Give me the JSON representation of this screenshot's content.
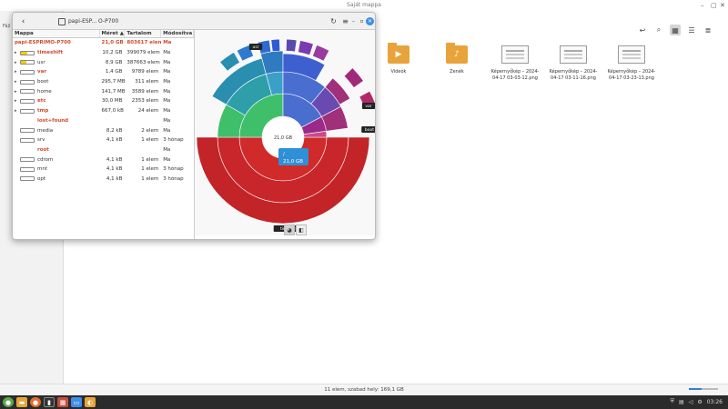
{
  "fm": {
    "title": "Saját mappa",
    "sidebar_label": "Fájl",
    "files": [
      {
        "name": "Videók",
        "type": "folder",
        "icon": "video-icon"
      },
      {
        "name": "Zenék",
        "type": "folder",
        "icon": "music-icon"
      },
      {
        "name": "Képernyőkép – 2024-04-17 03-03-12.png",
        "type": "image"
      },
      {
        "name": "Képernyőkép – 2024-04-17 03-11-16.png",
        "type": "image"
      },
      {
        "name": "Képernyőkép – 2024-04-17 03-23-13.png",
        "type": "image"
      }
    ],
    "status": "11 elem, szabad hely: 169,1 GB"
  },
  "taskbar": {
    "clock": "03:26",
    "zoom_fill": 0.45
  },
  "dua": {
    "location": "papi-ESP...   O-P700",
    "columns": {
      "name": "Mappa",
      "size": "Méret",
      "contents": "Tartalom",
      "modified": "Módosítva"
    },
    "rows": [
      {
        "name": "papi-ESPRIMO-P700",
        "size": "21,0 GB",
        "contents": "803617 elem",
        "modified": "Ma",
        "root": true
      },
      {
        "name": "timeshift",
        "size": "10,2 GB",
        "contents": "399079 elem",
        "modified": "Ma",
        "red": true,
        "fill": 0.5
      },
      {
        "name": "usr",
        "size": "8,9 GB",
        "contents": "387663 elem",
        "modified": "Ma",
        "fill": 0.4
      },
      {
        "name": "var",
        "size": "1,4 GB",
        "contents": "9789 elem",
        "modified": "Ma",
        "red": true
      },
      {
        "name": "boot",
        "size": "295,7 MB",
        "contents": "311 elem",
        "modified": "Ma"
      },
      {
        "name": "home",
        "size": "141,7 MB",
        "contents": "3589 elem",
        "modified": "Ma"
      },
      {
        "name": "etc",
        "size": "30,0 MB",
        "contents": "2353 elem",
        "modified": "Ma",
        "red": true
      },
      {
        "name": "tmp",
        "size": "667,0 kB",
        "contents": "24 elem",
        "modified": "Ma",
        "red": true
      },
      {
        "name": "lost+found",
        "size": "",
        "contents": "",
        "modified": "Ma",
        "red": true,
        "nobar": true
      },
      {
        "name": "media",
        "size": "8,2 kB",
        "contents": "2 elem",
        "modified": "Ma"
      },
      {
        "name": "srv",
        "size": "4,1 kB",
        "contents": "1 elem",
        "modified": "3 hónap"
      },
      {
        "name": "root",
        "size": "",
        "contents": "",
        "modified": "Ma",
        "red": true,
        "nobar": true
      },
      {
        "name": "cdrom",
        "size": "4,1 kB",
        "contents": "1 elem",
        "modified": "Ma"
      },
      {
        "name": "mnt",
        "size": "4,1 kB",
        "contents": "1 elem",
        "modified": "3 hónap"
      },
      {
        "name": "opt",
        "size": "4,1 kB",
        "contents": "1 elem",
        "modified": "3 hónap"
      }
    ],
    "chart": {
      "center_label": "21,0 GB",
      "tooltip_title": "/",
      "tooltip_value": "21,0 GB",
      "labels": [
        "usr",
        "var",
        "boot",
        "timeshift"
      ]
    }
  }
}
